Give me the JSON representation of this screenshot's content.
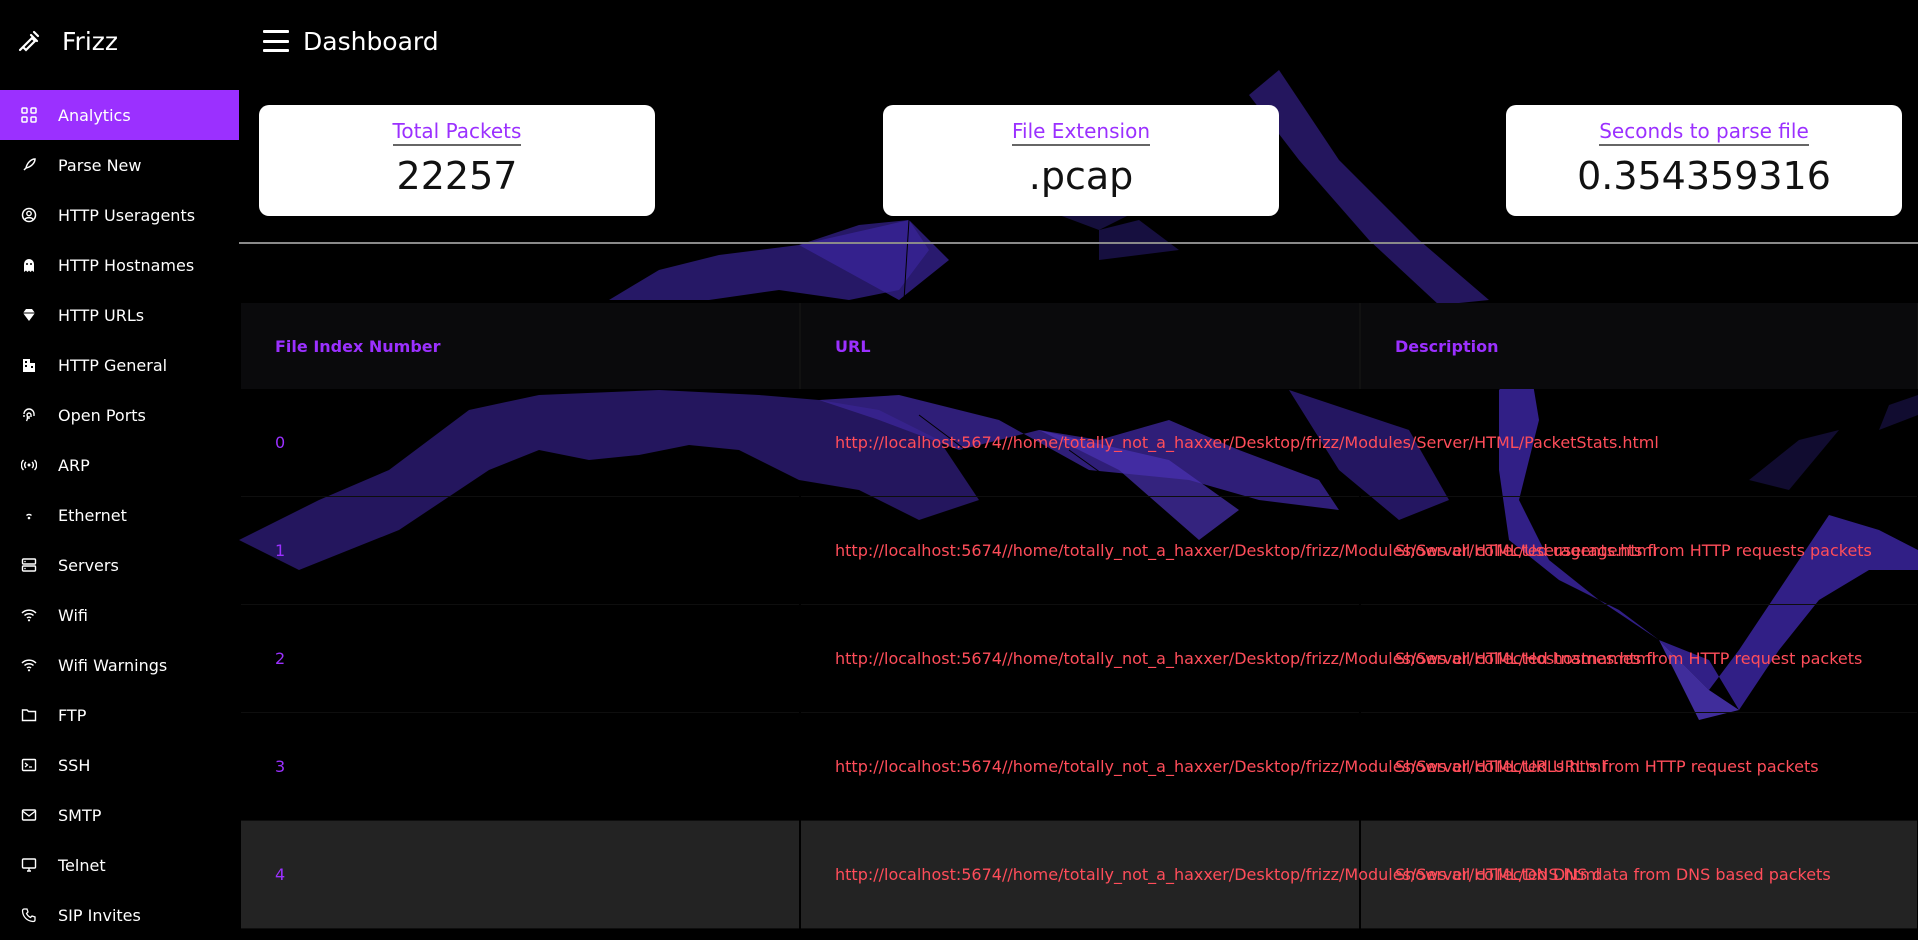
{
  "app": {
    "name": "Frizz"
  },
  "header": {
    "title": "Dashboard"
  },
  "sidebar": {
    "items": [
      {
        "label": "Analytics",
        "icon": "grid-icon",
        "active": true
      },
      {
        "label": "Parse New",
        "icon": "rocket-icon"
      },
      {
        "label": "HTTP Useragents",
        "icon": "user-circle-icon"
      },
      {
        "label": "HTTP Hostnames",
        "icon": "ghost-icon"
      },
      {
        "label": "HTTP URLs",
        "icon": "diamond-icon"
      },
      {
        "label": "HTTP General",
        "icon": "building-icon"
      },
      {
        "label": "Open Ports",
        "icon": "fingerprint-icon"
      },
      {
        "label": "ARP",
        "icon": "broadcast-icon"
      },
      {
        "label": "Ethernet",
        "icon": "signal-dot-icon"
      },
      {
        "label": "Servers",
        "icon": "server-icon"
      },
      {
        "label": "Wifi",
        "icon": "wifi-icon"
      },
      {
        "label": "Wifi Warnings",
        "icon": "wifi-icon"
      },
      {
        "label": "FTP",
        "icon": "folder-icon"
      },
      {
        "label": "SSH",
        "icon": "terminal-icon"
      },
      {
        "label": "SMTP",
        "icon": "mail-icon"
      },
      {
        "label": "Telnet",
        "icon": "monitor-icon"
      },
      {
        "label": "SIP Invites",
        "icon": "phone-icon"
      }
    ]
  },
  "stats": {
    "total_packets": {
      "label": "Total Packets",
      "value": "22257"
    },
    "file_extension": {
      "label": "File Extension",
      "value": ".pcap"
    },
    "parse_seconds": {
      "label": "Seconds to parse file",
      "value": "0.354359316"
    }
  },
  "table": {
    "headers": [
      "File Index Number",
      "URL",
      "Description"
    ],
    "rows": [
      {
        "index": "0",
        "url": "http://localhost:5674//home/totally_not_a_haxxer/Desktop/frizz/Modules/Server/HTML/PacketStats.html",
        "description": ""
      },
      {
        "index": "1",
        "url": "http://localhost:5674//home/totally_not_a_haxxer/Desktop/frizz/Modules/Server/HTML/Useragents.html",
        "description": "Shows all collected useragents from HTTP requests packets"
      },
      {
        "index": "2",
        "url": "http://localhost:5674//home/totally_not_a_haxxer/Desktop/frizz/Modules/Server/HTML/Hostnames.html",
        "description": "Shows all collected hostnames from HTTP request packets"
      },
      {
        "index": "3",
        "url": "http://localhost:5674//home/totally_not_a_haxxer/Desktop/frizz/Modules/Server/HTML/URLs.html",
        "description": "Shows all collected URL's from HTTP request packets"
      },
      {
        "index": "4",
        "url": "http://localhost:5674//home/totally_not_a_haxxer/Desktop/frizz/Modules/Server/HTML/DNS.html",
        "description": "Shows all collected DNS data from DNS based packets"
      }
    ]
  },
  "colors": {
    "accent": "#9b30ff",
    "link_red": "#ff4d5a",
    "background": "#000000"
  }
}
